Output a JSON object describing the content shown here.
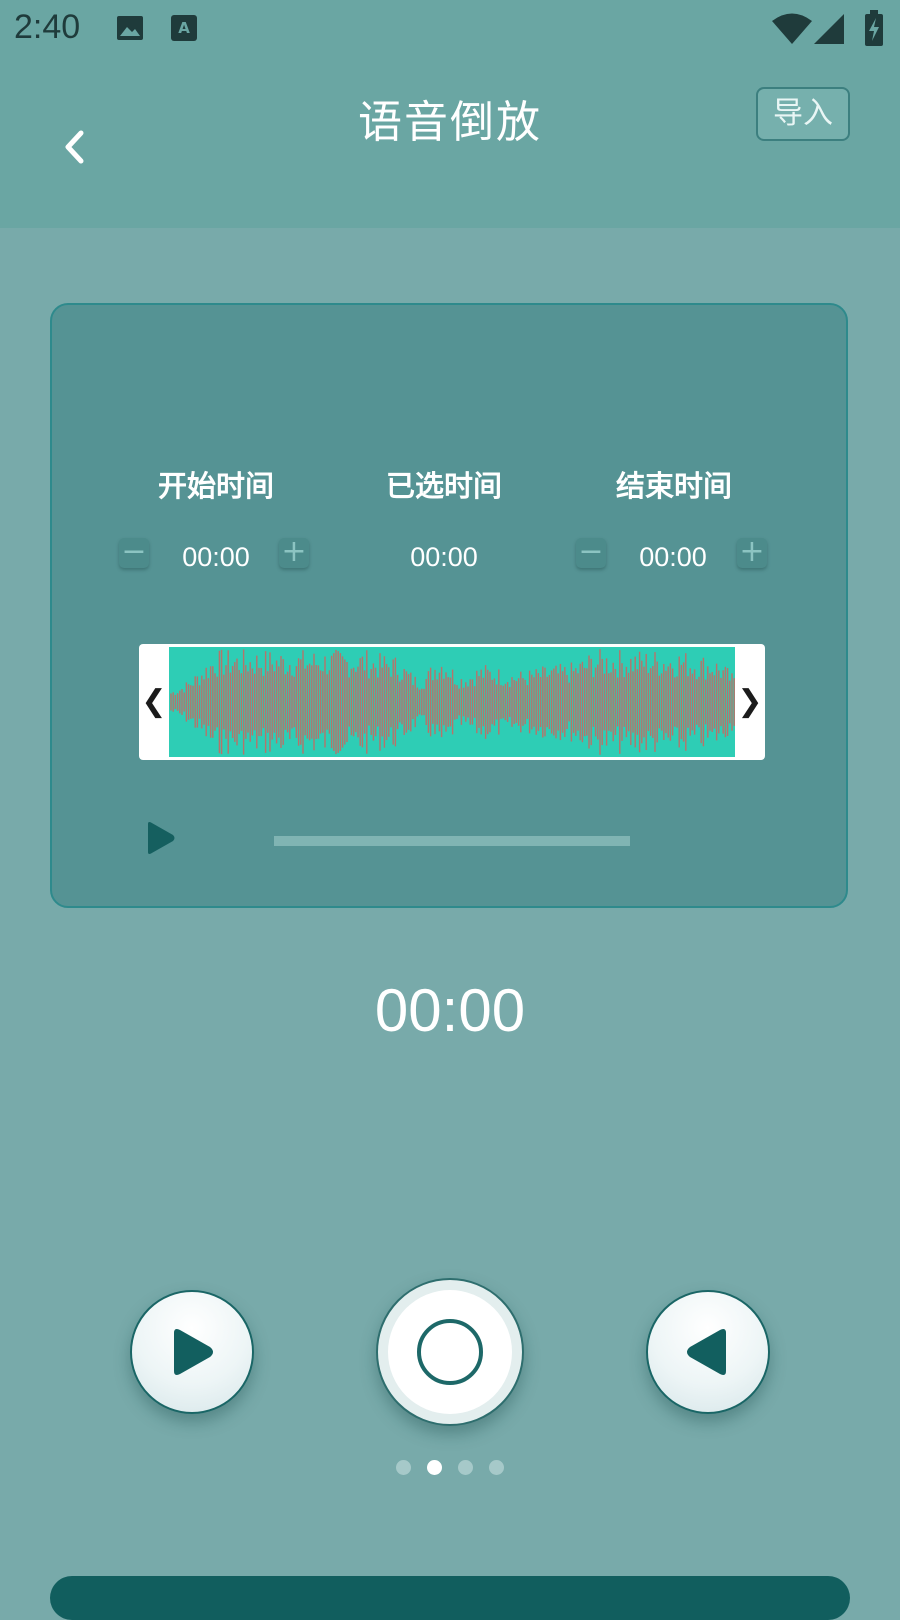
{
  "status_bar": {
    "time": "2:40",
    "icons": [
      "image-icon",
      "text-a-icon",
      "wifi-icon",
      "signal-icon",
      "battery-icon"
    ]
  },
  "header": {
    "title": "语音倒放",
    "import_label": "导入",
    "back_icon": "chevron-left-icon"
  },
  "editor": {
    "start_label": "开始时间",
    "selected_label": "已选时间",
    "end_label": "结束时间",
    "start_value": "00:00",
    "selected_value": "00:00",
    "end_value": "00:00",
    "minus_symbol": "−",
    "plus_symbol": "+",
    "left_handle": "❮",
    "right_handle": "❯",
    "playback_progress": 0
  },
  "timer": "00:00",
  "controls": [
    "play-icon",
    "record-icon",
    "reverse-play-icon"
  ],
  "pager": {
    "count": 4,
    "active": 1
  },
  "colors": {
    "background": "#78aaaa",
    "header": "#6aa6a3",
    "card": "#559394",
    "waveform_bg": "#2ecdb5",
    "waveform_bars": "#b7736a",
    "button_border": "#1a6666"
  }
}
